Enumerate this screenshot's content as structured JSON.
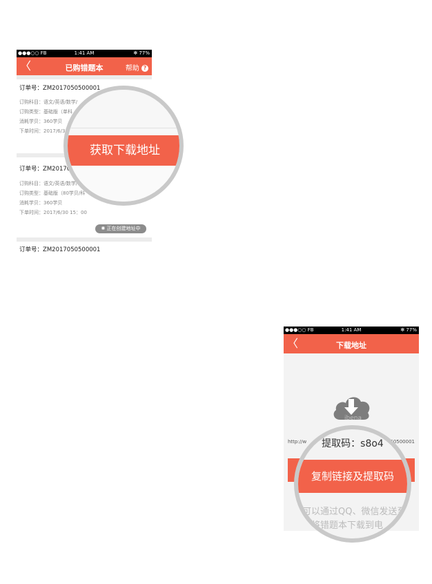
{
  "screen1": {
    "status": {
      "carrier": "●●●○○ FB",
      "time": "1:41 AM",
      "battery": "✻ 77%"
    },
    "nav": {
      "back": "〈",
      "title": "已购错题本",
      "help": "帮助",
      "help_icon": "?"
    },
    "orders": [
      {
        "order_no": "订单号：ZM2017050500001",
        "details": [
          "订购科目：语文/英语/数学/",
          "订购类型：基础版（单科",
          "消耗学贝：360学贝",
          "下单时间：2017/6/3"
        ]
      },
      {
        "order_no": "订单号：ZM201705",
        "details": [
          "订购科目：语文/英语/数学/",
          "订购类型：基础版（80学贝/科",
          "消耗学贝：360学贝",
          "下单时间：2017/6/30     15：00"
        ],
        "status": "正在创建地址中"
      },
      {
        "order_no": "订单号：ZM2017050500001",
        "details": []
      }
    ],
    "magnifier_button": "获取下载地址"
  },
  "screen2": {
    "status": {
      "carrier": "●●●○○ FB",
      "time": "1:41 AM",
      "battery": "✻ 77%"
    },
    "nav": {
      "back": "〈",
      "title": "下载地址"
    },
    "icon": "cloud-download-icon",
    "url_left": "http://w",
    "url_right": "0050500001",
    "ghost": "ibena",
    "magnifier": {
      "code": "提取码：s8o4",
      "copy_button": "复制链接及提取码",
      "hint1": "可以通过QQ、微信发送至",
      "hint2": "可将错题本下载到电"
    }
  },
  "colors": {
    "accent": "#f2624a",
    "lens_border": "#c9c9c9"
  }
}
